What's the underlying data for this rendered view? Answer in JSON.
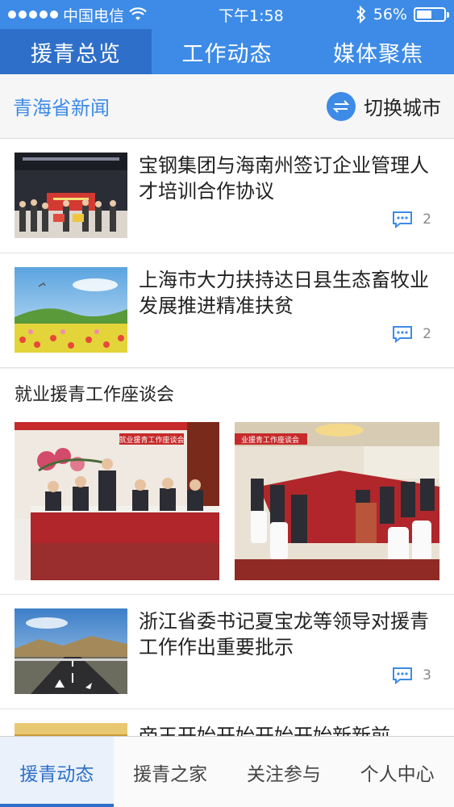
{
  "status_bar": {
    "carrier": "中国电信",
    "time": "下午1:58",
    "battery": "56%",
    "battery_level": 0.56
  },
  "top_tabs": [
    {
      "label": "援青总览",
      "active": true
    },
    {
      "label": "工作动态",
      "active": false
    },
    {
      "label": "媒体聚焦",
      "active": false
    }
  ],
  "section": {
    "title": "青海省新闻",
    "switch_label": "切换城市"
  },
  "news": [
    {
      "title": "宝钢集团与海南州签订企业管理人才培训合作协议",
      "comments": "2"
    },
    {
      "title": "上海市大力扶持达日县生态畜牧业发展推进精准扶贫",
      "comments": "2"
    },
    {
      "title": "浙江省委书记夏宝龙等领导对援青工作作出重要批示",
      "comments": "3"
    },
    {
      "title": "帝王开始开始开始开始新新前",
      "comments": ""
    }
  ],
  "gallery": {
    "title": "就业援青工作座谈会",
    "banner1": "就业援青工作座谈会",
    "banner2": "业援青工作座谈会"
  },
  "bottom_nav": [
    {
      "label": "援青动态",
      "active": true
    },
    {
      "label": "援青之家",
      "active": false
    },
    {
      "label": "关注参与",
      "active": false
    },
    {
      "label": "个人中心",
      "active": false
    }
  ],
  "colors": {
    "brand_blue": "#3d8be6",
    "active_tab_blue": "#2e6fc9"
  }
}
